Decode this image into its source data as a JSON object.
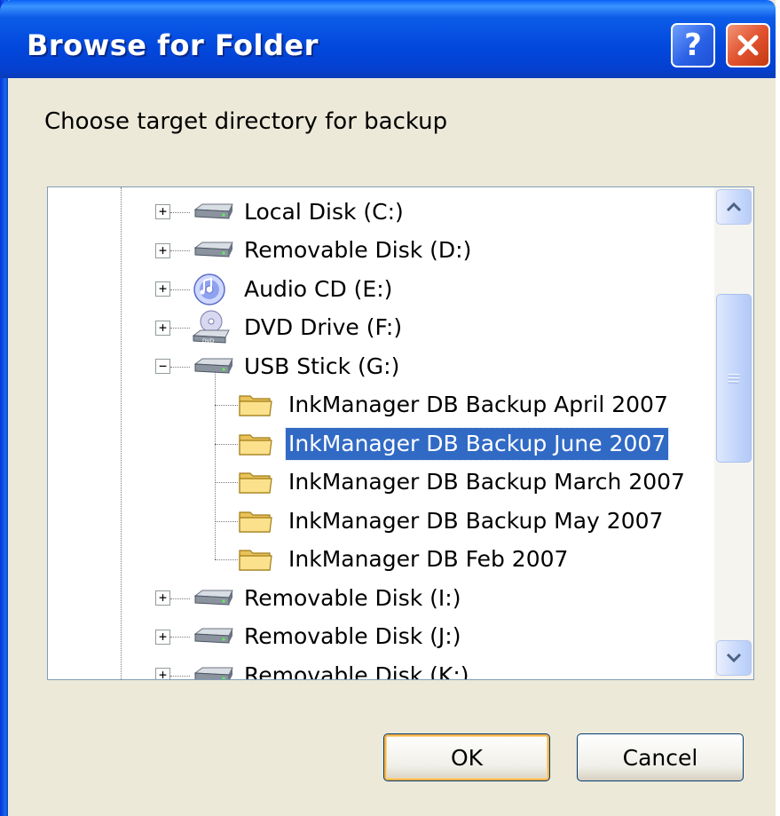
{
  "window": {
    "title": "Browse for Folder",
    "help_label": "?",
    "close_icon": "close-icon",
    "accent": "#0248dd"
  },
  "prompt": "Choose target directory for backup",
  "tree": {
    "nodes": [
      {
        "label": "Local Disk (C:)",
        "icon": "hard-drive-icon",
        "expander": "+"
      },
      {
        "label": "Removable Disk (D:)",
        "icon": "removable-drive-icon",
        "expander": "+"
      },
      {
        "label": "Audio CD (E:)",
        "icon": "audio-cd-icon",
        "expander": "+"
      },
      {
        "label": "DVD Drive (F:)",
        "icon": "dvd-drive-icon",
        "expander": "+"
      },
      {
        "label": "USB Stick (G:)",
        "icon": "removable-drive-icon",
        "expander": "−"
      },
      {
        "label": "InkManager DB Backup April 2007",
        "icon": "folder-icon"
      },
      {
        "label": "InkManager DB Backup June 2007",
        "icon": "folder-icon",
        "selected": true
      },
      {
        "label": "InkManager DB Backup March 2007",
        "icon": "folder-icon"
      },
      {
        "label": "InkManager DB Backup May 2007",
        "icon": "folder-icon"
      },
      {
        "label": "InkManager DB Feb 2007",
        "icon": "folder-icon"
      },
      {
        "label": "Removable Disk (I:)",
        "icon": "removable-drive-icon",
        "expander": "+"
      },
      {
        "label": "Removable Disk (J:)",
        "icon": "removable-drive-icon",
        "expander": "+"
      },
      {
        "label": "Removable Disk (K:)",
        "icon": "removable-drive-icon",
        "expander": "+"
      }
    ],
    "selection_color": "#316ac5"
  },
  "buttons": {
    "ok": "OK",
    "cancel": "Cancel"
  }
}
